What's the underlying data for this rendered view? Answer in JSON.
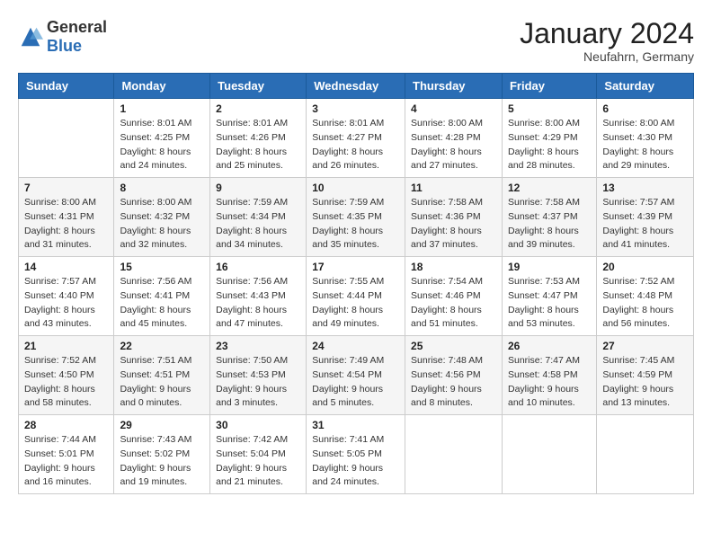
{
  "logo": {
    "general": "General",
    "blue": "Blue"
  },
  "title": "January 2024",
  "location": "Neufahrn, Germany",
  "days_of_week": [
    "Sunday",
    "Monday",
    "Tuesday",
    "Wednesday",
    "Thursday",
    "Friday",
    "Saturday"
  ],
  "weeks": [
    [
      {
        "day": "",
        "sunrise": "",
        "sunset": "",
        "daylight": ""
      },
      {
        "day": "1",
        "sunrise": "Sunrise: 8:01 AM",
        "sunset": "Sunset: 4:25 PM",
        "daylight": "Daylight: 8 hours and 24 minutes."
      },
      {
        "day": "2",
        "sunrise": "Sunrise: 8:01 AM",
        "sunset": "Sunset: 4:26 PM",
        "daylight": "Daylight: 8 hours and 25 minutes."
      },
      {
        "day": "3",
        "sunrise": "Sunrise: 8:01 AM",
        "sunset": "Sunset: 4:27 PM",
        "daylight": "Daylight: 8 hours and 26 minutes."
      },
      {
        "day": "4",
        "sunrise": "Sunrise: 8:00 AM",
        "sunset": "Sunset: 4:28 PM",
        "daylight": "Daylight: 8 hours and 27 minutes."
      },
      {
        "day": "5",
        "sunrise": "Sunrise: 8:00 AM",
        "sunset": "Sunset: 4:29 PM",
        "daylight": "Daylight: 8 hours and 28 minutes."
      },
      {
        "day": "6",
        "sunrise": "Sunrise: 8:00 AM",
        "sunset": "Sunset: 4:30 PM",
        "daylight": "Daylight: 8 hours and 29 minutes."
      }
    ],
    [
      {
        "day": "7",
        "sunrise": "Sunrise: 8:00 AM",
        "sunset": "Sunset: 4:31 PM",
        "daylight": "Daylight: 8 hours and 31 minutes."
      },
      {
        "day": "8",
        "sunrise": "Sunrise: 8:00 AM",
        "sunset": "Sunset: 4:32 PM",
        "daylight": "Daylight: 8 hours and 32 minutes."
      },
      {
        "day": "9",
        "sunrise": "Sunrise: 7:59 AM",
        "sunset": "Sunset: 4:34 PM",
        "daylight": "Daylight: 8 hours and 34 minutes."
      },
      {
        "day": "10",
        "sunrise": "Sunrise: 7:59 AM",
        "sunset": "Sunset: 4:35 PM",
        "daylight": "Daylight: 8 hours and 35 minutes."
      },
      {
        "day": "11",
        "sunrise": "Sunrise: 7:58 AM",
        "sunset": "Sunset: 4:36 PM",
        "daylight": "Daylight: 8 hours and 37 minutes."
      },
      {
        "day": "12",
        "sunrise": "Sunrise: 7:58 AM",
        "sunset": "Sunset: 4:37 PM",
        "daylight": "Daylight: 8 hours and 39 minutes."
      },
      {
        "day": "13",
        "sunrise": "Sunrise: 7:57 AM",
        "sunset": "Sunset: 4:39 PM",
        "daylight": "Daylight: 8 hours and 41 minutes."
      }
    ],
    [
      {
        "day": "14",
        "sunrise": "Sunrise: 7:57 AM",
        "sunset": "Sunset: 4:40 PM",
        "daylight": "Daylight: 8 hours and 43 minutes."
      },
      {
        "day": "15",
        "sunrise": "Sunrise: 7:56 AM",
        "sunset": "Sunset: 4:41 PM",
        "daylight": "Daylight: 8 hours and 45 minutes."
      },
      {
        "day": "16",
        "sunrise": "Sunrise: 7:56 AM",
        "sunset": "Sunset: 4:43 PM",
        "daylight": "Daylight: 8 hours and 47 minutes."
      },
      {
        "day": "17",
        "sunrise": "Sunrise: 7:55 AM",
        "sunset": "Sunset: 4:44 PM",
        "daylight": "Daylight: 8 hours and 49 minutes."
      },
      {
        "day": "18",
        "sunrise": "Sunrise: 7:54 AM",
        "sunset": "Sunset: 4:46 PM",
        "daylight": "Daylight: 8 hours and 51 minutes."
      },
      {
        "day": "19",
        "sunrise": "Sunrise: 7:53 AM",
        "sunset": "Sunset: 4:47 PM",
        "daylight": "Daylight: 8 hours and 53 minutes."
      },
      {
        "day": "20",
        "sunrise": "Sunrise: 7:52 AM",
        "sunset": "Sunset: 4:48 PM",
        "daylight": "Daylight: 8 hours and 56 minutes."
      }
    ],
    [
      {
        "day": "21",
        "sunrise": "Sunrise: 7:52 AM",
        "sunset": "Sunset: 4:50 PM",
        "daylight": "Daylight: 8 hours and 58 minutes."
      },
      {
        "day": "22",
        "sunrise": "Sunrise: 7:51 AM",
        "sunset": "Sunset: 4:51 PM",
        "daylight": "Daylight: 9 hours and 0 minutes."
      },
      {
        "day": "23",
        "sunrise": "Sunrise: 7:50 AM",
        "sunset": "Sunset: 4:53 PM",
        "daylight": "Daylight: 9 hours and 3 minutes."
      },
      {
        "day": "24",
        "sunrise": "Sunrise: 7:49 AM",
        "sunset": "Sunset: 4:54 PM",
        "daylight": "Daylight: 9 hours and 5 minutes."
      },
      {
        "day": "25",
        "sunrise": "Sunrise: 7:48 AM",
        "sunset": "Sunset: 4:56 PM",
        "daylight": "Daylight: 9 hours and 8 minutes."
      },
      {
        "day": "26",
        "sunrise": "Sunrise: 7:47 AM",
        "sunset": "Sunset: 4:58 PM",
        "daylight": "Daylight: 9 hours and 10 minutes."
      },
      {
        "day": "27",
        "sunrise": "Sunrise: 7:45 AM",
        "sunset": "Sunset: 4:59 PM",
        "daylight": "Daylight: 9 hours and 13 minutes."
      }
    ],
    [
      {
        "day": "28",
        "sunrise": "Sunrise: 7:44 AM",
        "sunset": "Sunset: 5:01 PM",
        "daylight": "Daylight: 9 hours and 16 minutes."
      },
      {
        "day": "29",
        "sunrise": "Sunrise: 7:43 AM",
        "sunset": "Sunset: 5:02 PM",
        "daylight": "Daylight: 9 hours and 19 minutes."
      },
      {
        "day": "30",
        "sunrise": "Sunrise: 7:42 AM",
        "sunset": "Sunset: 5:04 PM",
        "daylight": "Daylight: 9 hours and 21 minutes."
      },
      {
        "day": "31",
        "sunrise": "Sunrise: 7:41 AM",
        "sunset": "Sunset: 5:05 PM",
        "daylight": "Daylight: 9 hours and 24 minutes."
      },
      {
        "day": "",
        "sunrise": "",
        "sunset": "",
        "daylight": ""
      },
      {
        "day": "",
        "sunrise": "",
        "sunset": "",
        "daylight": ""
      },
      {
        "day": "",
        "sunrise": "",
        "sunset": "",
        "daylight": ""
      }
    ]
  ]
}
